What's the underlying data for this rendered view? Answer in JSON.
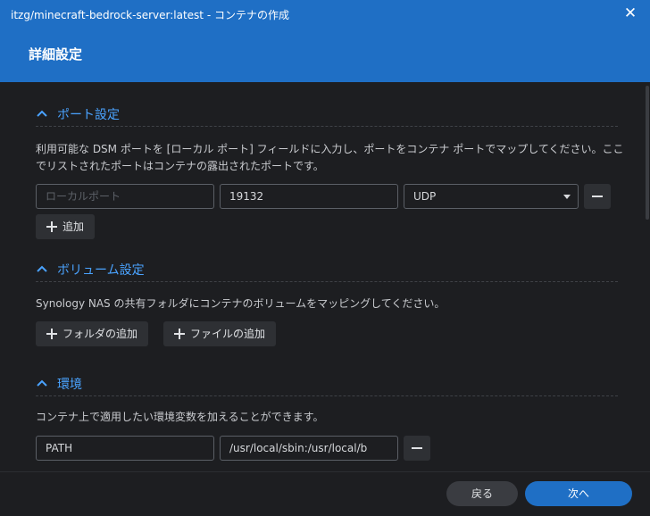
{
  "window": {
    "title": "itzg/minecraft-bedrock-server:latest - コンテナの作成",
    "header_title": "詳細設定",
    "close_icon": "close-icon"
  },
  "port_section": {
    "title": "ポート設定",
    "description": "利用可能な DSM ポートを [ローカル ポート] フィールドに入力し、ポートをコンテナ ポートでマップしてください。ここでリストされたポートはコンテナの露出されたポートです。",
    "rows": [
      {
        "local_port_value": "",
        "local_port_placeholder": "ローカルポート",
        "container_port": "19132",
        "protocol": "UDP"
      }
    ],
    "add_label": "追加"
  },
  "volume_section": {
    "title": "ボリューム設定",
    "description": "Synology NAS の共有フォルダにコンテナのボリュームをマッピングしてください。",
    "add_folder_label": "フォルダの追加",
    "add_file_label": "ファイルの追加"
  },
  "env_section": {
    "title": "環境",
    "description": "コンテナ上で適用したい環境変数を加えることができます。",
    "rows": [
      {
        "key": "PATH",
        "value": "/usr/local/sbin:/usr/local/b"
      }
    ]
  },
  "footer": {
    "back_label": "戻る",
    "next_label": "次へ"
  },
  "colors": {
    "accent": "#1f6fc5",
    "section_title": "#4aa3ff",
    "background": "#1d1e21"
  }
}
